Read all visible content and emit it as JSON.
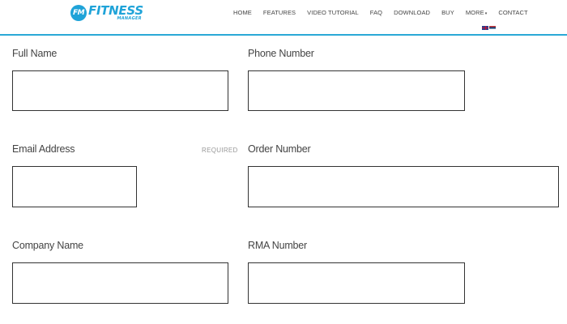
{
  "brand": {
    "badge": "FM",
    "name": "FITNESS",
    "tagline": "MANAGER",
    "accent_color": "#1fa3d8"
  },
  "nav": {
    "items": [
      "HOME",
      "FEATURES",
      "VIDEO TUTORIAL",
      "FAQ",
      "DOWNLOAD",
      "BUY",
      "MORE",
      "CONTACT"
    ],
    "more_caret_icon": "caret-down-icon"
  },
  "language_flags": [
    "uk-flag-icon",
    "serbia-flag-icon"
  ],
  "form": {
    "full_name": {
      "label": "Full Name",
      "value": ""
    },
    "phone_number": {
      "label": "Phone Number",
      "value": ""
    },
    "email_address": {
      "label": "Email Address",
      "required_text": "REQUIRED",
      "value": ""
    },
    "order_number": {
      "label": "Order Number",
      "value": ""
    },
    "company_name": {
      "label": "Company Name",
      "value": ""
    },
    "rma_number": {
      "label": "RMA Number",
      "value": ""
    }
  }
}
